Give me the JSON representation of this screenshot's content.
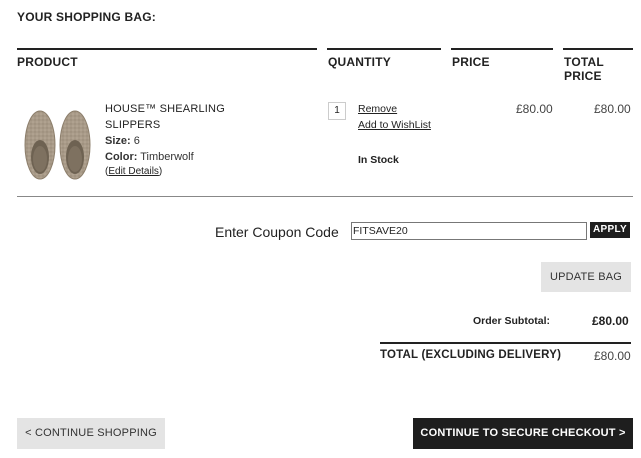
{
  "page": {
    "title": "YOUR SHOPPING BAG:"
  },
  "columns": {
    "product": "PRODUCT",
    "quantity": "QUANTITY",
    "price": "PRICE",
    "total_price": "TOTAL PRICE"
  },
  "item": {
    "name": "HOUSE™ SHEARLING SLIPPERS",
    "size_label": "Size:",
    "size_value": "6",
    "color_label": "Color:",
    "color_value": "Timberwolf",
    "edit_open": "(",
    "edit_link": "Edit Details",
    "edit_close": ")",
    "quantity": "1",
    "remove_link": "Remove",
    "wishlist_link": "Add to WishList",
    "stock_status": "In Stock",
    "price": "£80.00",
    "total_price": "£80.00",
    "image_icon": "slippers-product-image",
    "image_color": "#a89a88"
  },
  "coupon": {
    "label": "Enter Coupon Code",
    "value": "FITSAVE20",
    "apply_label": "APPLY"
  },
  "update_bag_label": "UPDATE BAG",
  "summary": {
    "subtotal_label": "Order Subtotal:",
    "subtotal_value": "£80.00",
    "total_label": "TOTAL (EXCLUDING DELIVERY)",
    "total_value": "£80.00"
  },
  "footer": {
    "continue_shopping_label": "< CONTINUE SHOPPING",
    "checkout_label": "CONTINUE TO SECURE CHECKOUT >"
  }
}
